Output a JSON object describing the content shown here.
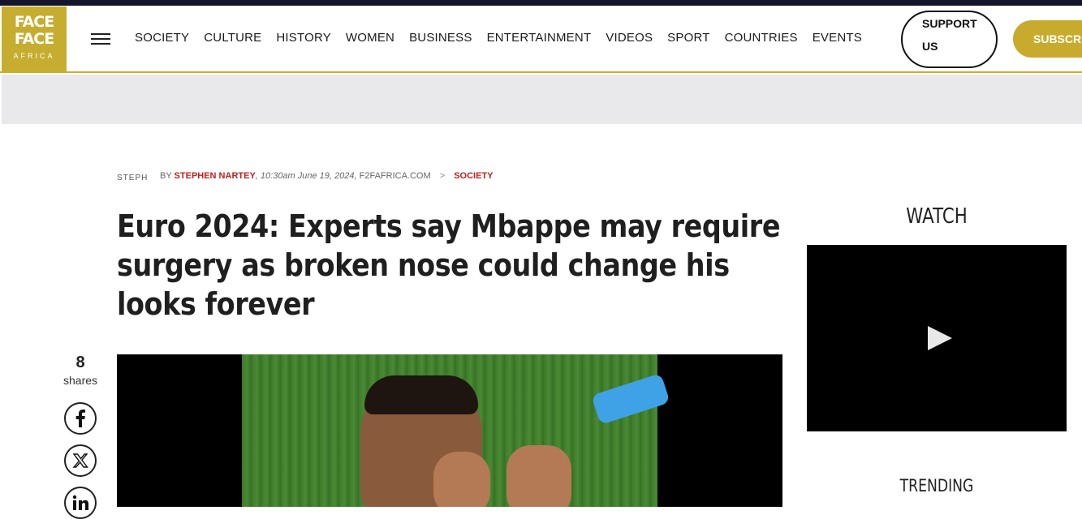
{
  "brand": {
    "line1": "FACE",
    "line2": "FACE",
    "line3": "AFRICA",
    "color": "#c6ad2f"
  },
  "nav": {
    "items": [
      "SOCIETY",
      "CULTURE",
      "HISTORY",
      "WOMEN",
      "BUSINESS",
      "ENTERTAINMENT",
      "VIDEOS",
      "SPORT",
      "COUNTRIES",
      "EVENTS"
    ],
    "support_line1": "SUPPORT",
    "support_line2": "US",
    "subscribe": "SUBSCRIBE"
  },
  "article": {
    "avatar_alt": "STEPH",
    "by": "BY",
    "author": "STEPHEN NARTEY",
    "date": ", 10:30am June 19, 2024,",
    "site": " F2FAFRICA.COM",
    "sep": ">",
    "category": "SOCIETY",
    "title": "Euro 2024: Experts say Mbappe may require surgery as broken nose could change his looks forever",
    "shares_count": "8",
    "shares_label": "shares"
  },
  "sidebar": {
    "watch": "WATCH",
    "trending": "TRENDING"
  },
  "icons": {
    "menu": "hamburger-menu-icon",
    "facebook": "facebook-icon",
    "x": "x-twitter-icon",
    "linkedin": "linkedin-icon",
    "play": "play-icon"
  }
}
